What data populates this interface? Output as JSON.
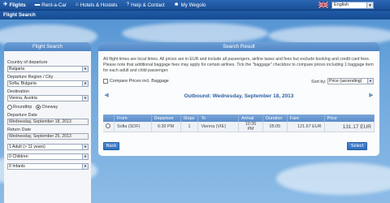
{
  "nav": {
    "items": [
      {
        "label": "Flights",
        "icon": "plane-icon",
        "glyph": "✈"
      },
      {
        "label": "Rent-a-Car",
        "icon": "car-icon",
        "glyph": "▬"
      },
      {
        "label": "Hotels & Hostels",
        "icon": "home-icon",
        "glyph": "⌂"
      },
      {
        "label": "Help & Contact",
        "icon": "help-icon",
        "glyph": "?"
      },
      {
        "label": "My Wegolo",
        "icon": "user-icon",
        "glyph": "☻"
      }
    ],
    "language": "English"
  },
  "subbar": {
    "title": "Flight Search"
  },
  "search": {
    "heading": "Flight Search",
    "country_label": "Country of departure",
    "country_value": "Bulgaria",
    "region_label": "Departure Region / City",
    "region_value": "Sofia, Bulgaria",
    "destination_label": "Destination",
    "destination_value": "Vienna, Austria",
    "roundtrip_label": "Roundtrip",
    "oneway_label": "Oneway",
    "departure_date_label": "Departure Date",
    "departure_date_value": "Wednesday, September 18, 2013",
    "return_date_label": "Return Date",
    "return_date_value": "Wednesday, September 25, 2013",
    "adults_value": "1 Adult (> 11 years)",
    "children_value": "0 Children",
    "infants_value": "0 Infants"
  },
  "result": {
    "heading": "Search Result",
    "info": "All flight times are local times. All prices are in EUR and include all passengers, airline taxes and fees but exclude booking and credit card fees. Please note that additional baggage fees may apply for certain airlines. Tick the \"baggage\" checkbox to compare prices including 1 baggage item for each adult and child passenger.",
    "compare_label": "Compare Prices incl. Baggage",
    "sort_label": "Sort by:",
    "sort_value": "Price (ascending)",
    "outbound_title": "Outbound: Wednesday, September 18, 2013",
    "columns": [
      "From",
      "Departure",
      "Stops",
      "To",
      "Arrival",
      "Duration",
      "Fare",
      "Price"
    ],
    "rows": [
      {
        "from": "Sofia (SOF)",
        "departure": "6:30 PM",
        "stops": "1",
        "to": "Vienna (VIE)",
        "arrival": "10:35 PM",
        "duration": "05:05",
        "fare": "121.67 EUR",
        "price": "131.17 EUR"
      }
    ],
    "back_label": "Back",
    "select_label": "Select"
  }
}
